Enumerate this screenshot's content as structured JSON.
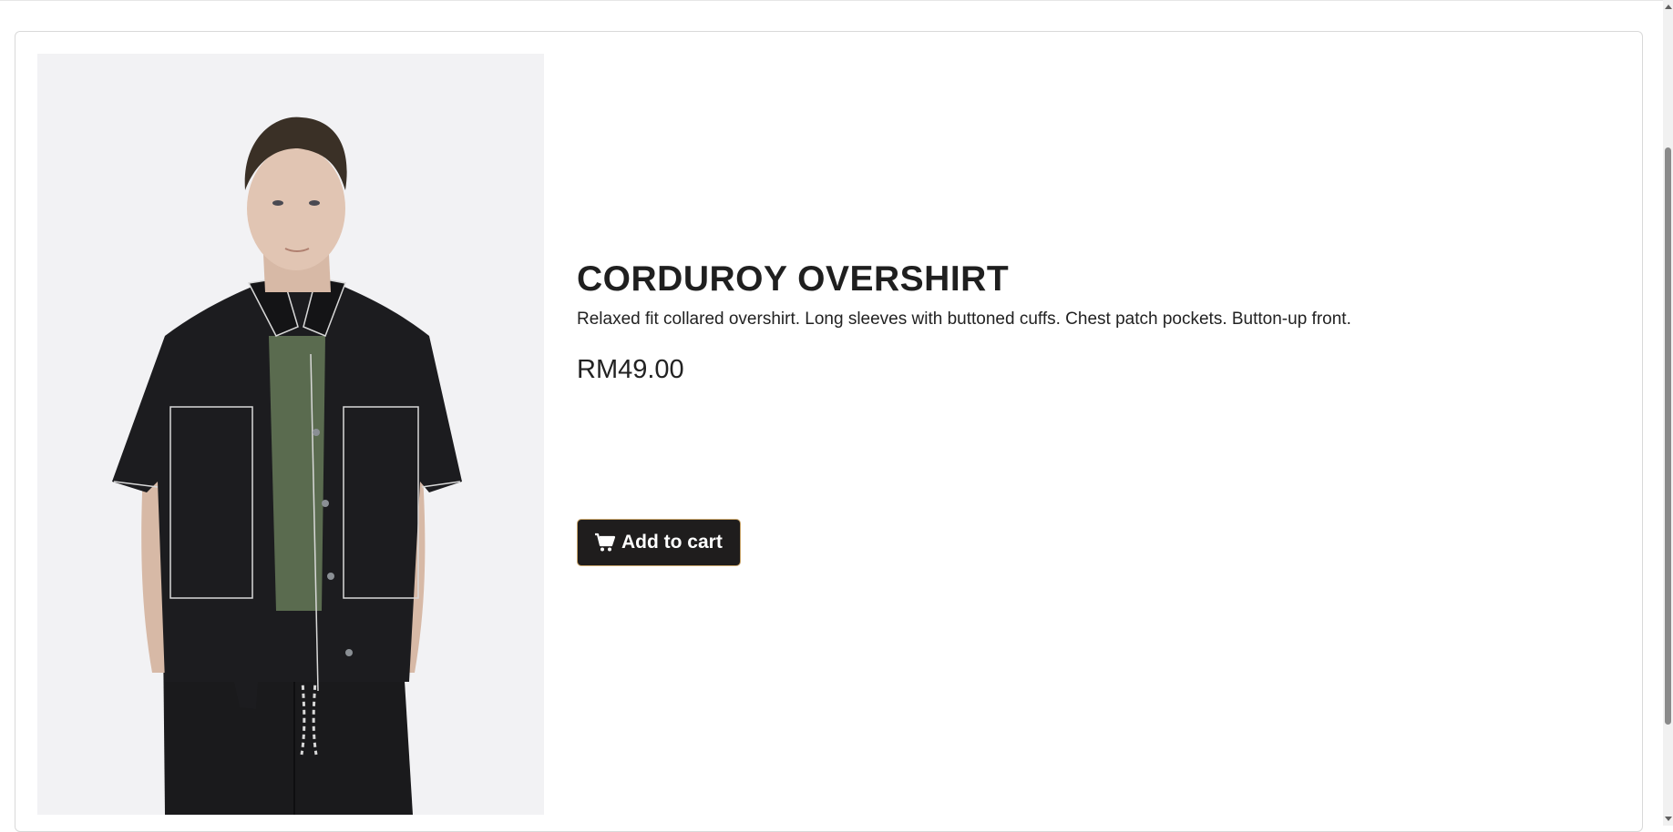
{
  "product": {
    "title": "CORDUROY OVERSHIRT",
    "description": "Relaxed fit collared overshirt. Long sleeves with buttoned cuffs. Chest patch pockets. Button-up front.",
    "price": "RM49.00",
    "image_icon": "product-photo",
    "add_to_cart_label": "Add to cart",
    "cart_icon": "cart-icon"
  },
  "colors": {
    "button_bg": "#1f1d1d",
    "button_border": "#c8a46a",
    "text": "#222222"
  }
}
